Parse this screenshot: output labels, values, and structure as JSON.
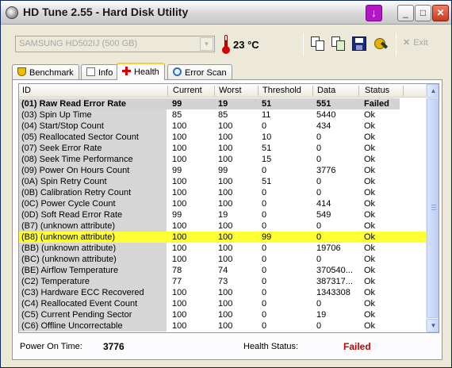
{
  "window": {
    "title": "HD Tune 2.55 - Hard Disk Utility"
  },
  "toolbar": {
    "drive": "SAMSUNG HD502IJ (500 GB)",
    "temperature": "23 °C",
    "exit_label": "Exit"
  },
  "tabs": [
    {
      "label": "Benchmark",
      "icon": "benchmark-icon"
    },
    {
      "label": "Info",
      "icon": "info-icon"
    },
    {
      "label": "Health",
      "icon": "health-cross-icon",
      "active": true
    },
    {
      "label": "Error Scan",
      "icon": "magnifier-icon"
    }
  ],
  "table": {
    "columns": [
      "ID",
      "Current",
      "Worst",
      "Threshold",
      "Data",
      "Status"
    ],
    "rows": [
      [
        "(01) Raw Read Error Rate",
        "99",
        "19",
        "51",
        "551",
        "Failed"
      ],
      [
        "(03) Spin Up Time",
        "85",
        "85",
        "11",
        "5440",
        "Ok"
      ],
      [
        "(04) Start/Stop Count",
        "100",
        "100",
        "0",
        "434",
        "Ok"
      ],
      [
        "(05) Reallocated Sector Count",
        "100",
        "100",
        "10",
        "0",
        "Ok"
      ],
      [
        "(07) Seek Error Rate",
        "100",
        "100",
        "51",
        "0",
        "Ok"
      ],
      [
        "(08) Seek Time Performance",
        "100",
        "100",
        "15",
        "0",
        "Ok"
      ],
      [
        "(09) Power On Hours Count",
        "99",
        "99",
        "0",
        "3776",
        "Ok"
      ],
      [
        "(0A) Spin Retry Count",
        "100",
        "100",
        "51",
        "0",
        "Ok"
      ],
      [
        "(0B) Calibration Retry Count",
        "100",
        "100",
        "0",
        "0",
        "Ok"
      ],
      [
        "(0C) Power Cycle Count",
        "100",
        "100",
        "0",
        "414",
        "Ok"
      ],
      [
        "(0D) Soft Read Error Rate",
        "99",
        "19",
        "0",
        "549",
        "Ok"
      ],
      [
        "(B7) (unknown attribute)",
        "100",
        "100",
        "0",
        "0",
        "Ok"
      ],
      [
        "(B8) (unknown attribute)",
        "100",
        "100",
        "99",
        "0",
        "Ok"
      ],
      [
        "(BB) (unknown attribute)",
        "100",
        "100",
        "0",
        "19706",
        "Ok"
      ],
      [
        "(BC) (unknown attribute)",
        "100",
        "100",
        "0",
        "0",
        "Ok"
      ],
      [
        "(BE) Airflow Temperature",
        "78",
        "74",
        "0",
        "370540...",
        "Ok"
      ],
      [
        "(C2) Temperature",
        "77",
        "73",
        "0",
        "387317...",
        "Ok"
      ],
      [
        "(C3) Hardware ECC Recovered",
        "100",
        "100",
        "0",
        "1343308",
        "Ok"
      ],
      [
        "(C4) Reallocated Event Count",
        "100",
        "100",
        "0",
        "0",
        "Ok"
      ],
      [
        "(C5) Current Pending Sector",
        "100",
        "100",
        "0",
        "19",
        "Ok"
      ],
      [
        "(C6) Offline Uncorrectable",
        "100",
        "100",
        "0",
        "0",
        "Ok"
      ]
    ],
    "failed_row": 0,
    "highlighted_row": 12
  },
  "footer": {
    "power_on_label": "Power On Time:",
    "power_on_value": "3776",
    "health_label": "Health Status:",
    "health_value": "Failed"
  },
  "colors": {
    "failed": "#c00000",
    "highlight": "#ffff33",
    "tab_accent": "#ffc83c"
  }
}
